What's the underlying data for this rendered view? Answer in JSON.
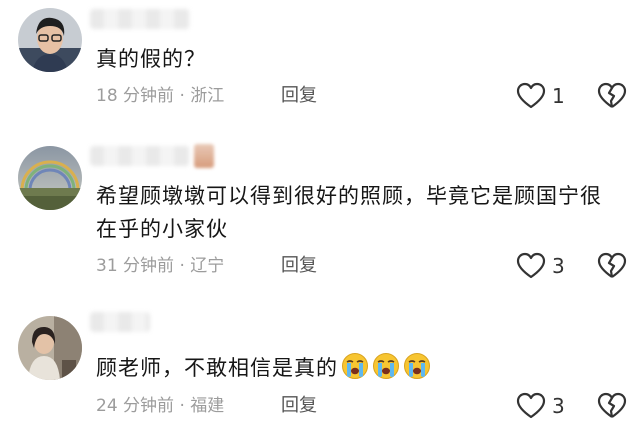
{
  "comments": [
    {
      "text": "真的假的？",
      "time": "18 分钟前",
      "region": "浙江",
      "reply_label": "回复",
      "likes": "1",
      "emoji_count": 0
    },
    {
      "text": "希望顾墩墩可以得到很好的照顾，毕竟它是顾国宁很在乎的小家伙",
      "time": "31 分钟前",
      "region": "辽宁",
      "reply_label": "回复",
      "likes": "3",
      "emoji_count": 0
    },
    {
      "text": "顾老师，不敢相信是真的",
      "time": "24 分钟前",
      "region": "福建",
      "reply_label": "回复",
      "likes": "3",
      "emoji_count": 3,
      "emoji_icon": "loudly-crying-face-icon"
    }
  ],
  "meta_separator": " · ",
  "colors": {
    "text": "#161616",
    "meta": "#9c9c9c",
    "reply": "#555555"
  }
}
